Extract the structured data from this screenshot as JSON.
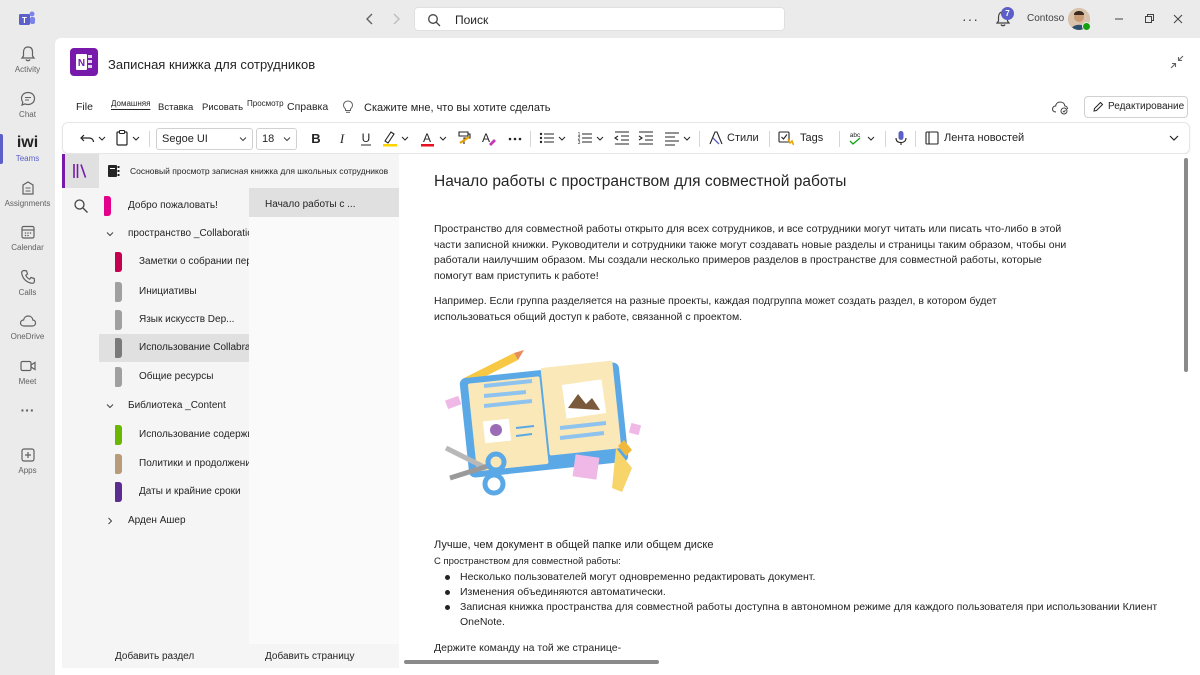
{
  "titlebar": {
    "search_placeholder": "Поиск",
    "more": "···",
    "notifications_count": "7",
    "org_name": "Contoso"
  },
  "rail": {
    "items": [
      {
        "label": "Activity",
        "icon": "bell-icon"
      },
      {
        "label": "Chat",
        "icon": "chat-icon"
      },
      {
        "label": "Teams",
        "icon": "teams-icon",
        "glyph": "iwi"
      },
      {
        "label": "Assignments",
        "icon": "assignments-icon"
      },
      {
        "label": "Calendar",
        "icon": "calendar-icon"
      },
      {
        "label": "Calls",
        "icon": "phone-icon"
      },
      {
        "label": "OneDrive",
        "icon": "cloud-icon"
      },
      {
        "label": "Meet",
        "icon": "video-icon"
      },
      {
        "label": "···",
        "icon": "more-icon"
      },
      {
        "label": "Apps",
        "icon": "apps-icon"
      }
    ]
  },
  "app": {
    "title": "Записная книжка для сотрудников"
  },
  "ribbon": {
    "tabs": [
      "File",
      "Домашняя",
      "Вставка",
      "Рисовать",
      "Просмотр",
      "Справка"
    ],
    "selected_tab": "Домашняя",
    "tell_me": "Скажите мне, что вы хотите сделать",
    "edit_button": "Редактирование"
  },
  "toolbar": {
    "font": "Segoe UI",
    "size": "18",
    "styles_label": "Стили",
    "tags_label": "Tags",
    "spell_label": "abc",
    "feed_label": "Лента новостей",
    "highlight_color": "#ffd400",
    "font_color": "#e81123"
  },
  "notebook": {
    "title": "Сосновый просмотр записная книжка для школьных сотрудников",
    "sections": [
      {
        "kind": "section",
        "label": "Добро пожаловать!",
        "color": "#e3008c"
      },
      {
        "kind": "group",
        "label": "пространство _Collaboration",
        "expanded": true
      },
      {
        "kind": "section",
        "label": "Заметки о собрании персонала",
        "color": "#c4004f"
      },
      {
        "kind": "section",
        "label": "Инициативы",
        "color": "#a0a0a0"
      },
      {
        "kind": "section",
        "label": "Язык искусств Dep...",
        "color": "#a0a0a0"
      },
      {
        "kind": "section",
        "label": "Использование Collabra",
        "color": "#7a7a7a",
        "selected": true
      },
      {
        "kind": "section",
        "label": "Общие ресурсы",
        "color": "#a0a0a0"
      },
      {
        "kind": "group",
        "label": "Библиотека _Content",
        "expanded": true
      },
      {
        "kind": "section",
        "label": "Использование содержимого",
        "color": "#6bb700"
      },
      {
        "kind": "section",
        "label": "Политики и продолжение",
        "color": "#b89c7a"
      },
      {
        "kind": "section",
        "label": "Даты и крайние сроки",
        "color": "#5c2d91"
      },
      {
        "kind": "group",
        "label": "Арден Ашер",
        "expanded": false
      }
    ],
    "selected_page": "Начало работы с ...",
    "add_section": "Добавить раздел",
    "add_page": "Добавить страницу"
  },
  "page": {
    "title": "Начало работы с пространством для совместной работы",
    "para1": "Пространство для совместной работы открыто для всех сотрудников, и все сотрудники могут читать или писать что-либо в этой части записной книжки. Руководители и сотрудники также могут создавать новые разделы и страницы таким образом, чтобы они работали наилучшим образом. Мы создали несколько примеров разделов в пространстве для совместной работы, которые помогут вам приступить к работе!",
    "para2": "Например. Если группа разделяется на разные проекты, каждая подгруппа может создать раздел, в котором будет использоваться общий доступ к работе, связанной с проектом.",
    "sub_heading": "Лучше, чем документ в общей папке или общем диске",
    "sub_intro": "С пространством для совместной работы:",
    "bullets": [
      "Несколько пользователей могут одновременно редактировать документ.",
      "Изменения объединяются автоматически.",
      "Записная книжка пространства для совместной работы доступна в автономном режиме для каждого пользователя при использовании Клиент OneNote."
    ],
    "last_line": "Держите команду на той же странице-"
  }
}
